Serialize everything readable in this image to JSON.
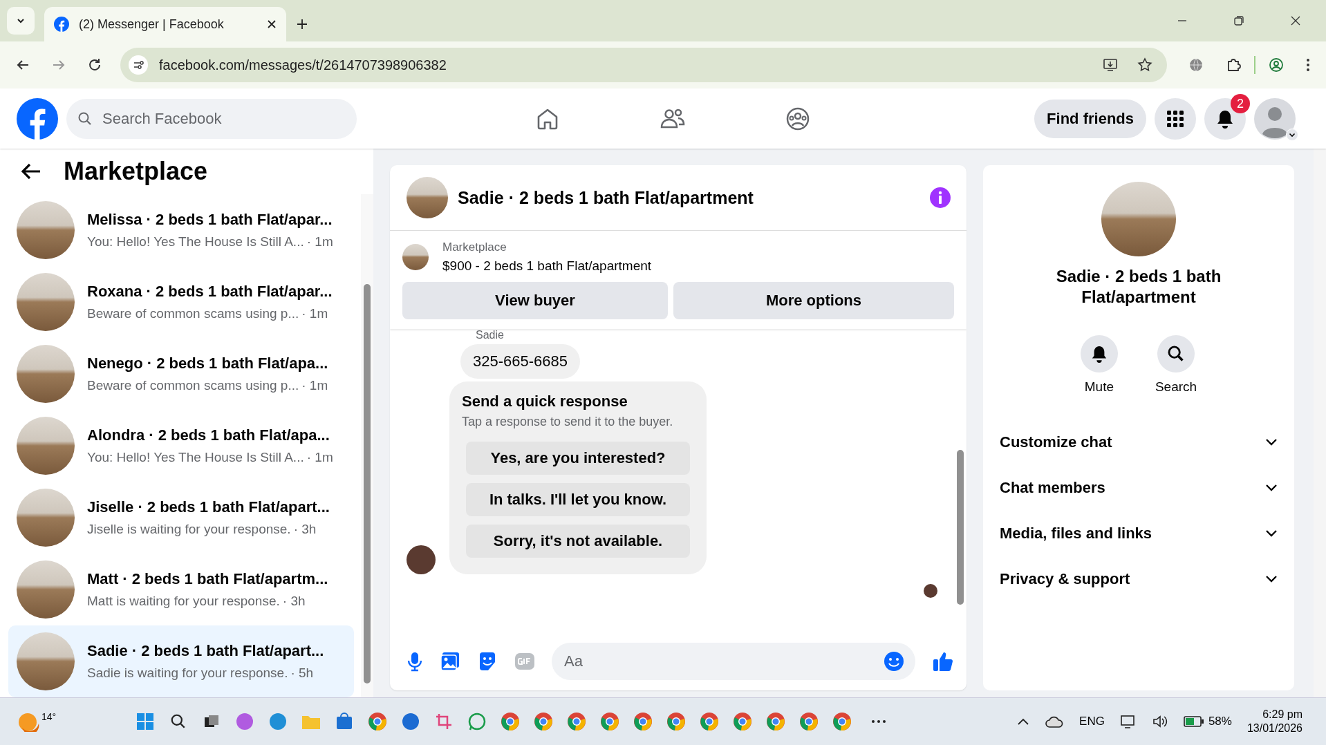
{
  "browser": {
    "tab_title": "(2) Messenger | Facebook",
    "url": "facebook.com/messages/t/2614707398906382"
  },
  "top_nav": {
    "search_placeholder": "Search Facebook",
    "find_friends": "Find friends",
    "notification_count": "2"
  },
  "sidebar": {
    "title": "Marketplace",
    "conversations": [
      {
        "name": "Melissa · 2 beds 1 bath Flat/apar...",
        "preview": "You: Hello! Yes The House Is Still A...",
        "time": "· 1m",
        "selected": false
      },
      {
        "name": "Roxana · 2 beds 1 bath Flat/apar...",
        "preview": "Beware of common scams using p...",
        "time": "· 1m",
        "selected": false
      },
      {
        "name": "Nenego · 2 beds 1 bath Flat/apa...",
        "preview": "Beware of common scams using p...",
        "time": "· 1m",
        "selected": false
      },
      {
        "name": "Alondra · 2 beds 1 bath Flat/apa...",
        "preview": "You: Hello! Yes The House Is Still A...",
        "time": "· 1m",
        "selected": false
      },
      {
        "name": "Jiselle · 2 beds 1 bath Flat/apart...",
        "preview": "Jiselle is waiting for your response.",
        "time": "· 3h",
        "selected": false
      },
      {
        "name": "Matt · 2 beds 1 bath Flat/apartm...",
        "preview": "Matt is waiting for your response.",
        "time": "· 3h",
        "selected": false
      },
      {
        "name": "Sadie · 2 beds 1 bath Flat/apart...",
        "preview": "Sadie is waiting for your response.",
        "time": "· 5h",
        "selected": true
      }
    ]
  },
  "chat": {
    "title": "Sadie · 2 beds 1 bath Flat/apartment",
    "listing": {
      "label": "Marketplace",
      "title": "$900 - 2 beds 1 bath Flat/apartment"
    },
    "buttons": [
      "View buyer",
      "More options"
    ],
    "sender": "Sadie",
    "message": "325-665-6685",
    "quick_response": {
      "title": "Send a quick response",
      "hint": "Tap a response to send it to the buyer.",
      "options": [
        "Yes, are you interested?",
        "In talks. I'll let you know.",
        "Sorry, it's not available."
      ]
    },
    "composer_placeholder": "Aa"
  },
  "details": {
    "name": "Sadie · 2 beds 1 bath Flat/apartment",
    "actions": [
      {
        "label": "Mute",
        "kind": "bell"
      },
      {
        "label": "Search",
        "kind": "search"
      }
    ],
    "sections": [
      "Customize chat",
      "Chat members",
      "Media, files and links",
      "Privacy & support"
    ]
  },
  "taskbar": {
    "weather": "14°",
    "language": "ENG",
    "battery": "58%",
    "time": "6:29 pm",
    "date": "13/01/2026"
  }
}
